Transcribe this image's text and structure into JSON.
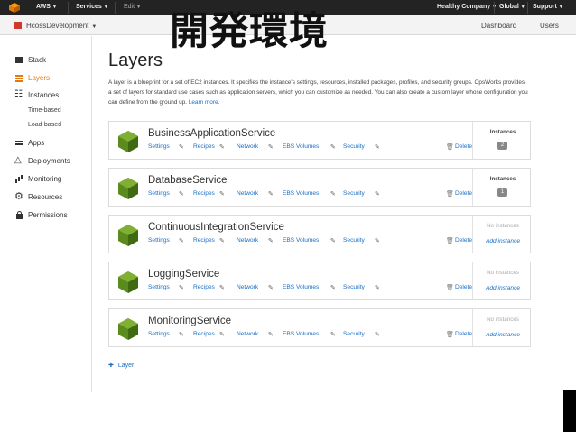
{
  "topbar": {
    "brand": "AWS",
    "services": "Services",
    "edit": "Edit",
    "account": "Healthy Company",
    "region": "Global",
    "support": "Support"
  },
  "subbar": {
    "stack_name": "HcossDevelopment",
    "dashboard": "Dashboard",
    "users": "Users"
  },
  "overlay_title": "開発環境",
  "sidebar": {
    "stack": "Stack",
    "layers": "Layers",
    "instances": "Instances",
    "time_based": "Time-based",
    "load_based": "Load-based",
    "apps": "Apps",
    "deployments": "Deployments",
    "monitoring": "Monitoring",
    "resources": "Resources",
    "permissions": "Permissions"
  },
  "main": {
    "title": "Layers",
    "description": "A layer is a blueprint for a set of EC2 instances. It specifies the instance's settings, resources, installed packages, profiles, and security groups. OpsWorks provides a set of layers for standard use cases such as application servers, which you can customize as needed. You can also create a custom layer whose configuration you can define from the ground up.",
    "learn_more": "Learn more.",
    "add_layer": "Layer"
  },
  "actions": {
    "settings": "Settings",
    "recipes": "Recipes",
    "network": "Network",
    "ebs": "EBS Volumes",
    "security": "Security",
    "delete": "Delete"
  },
  "layers": [
    {
      "name": "BusinessApplicationService",
      "instances_label": "Instances",
      "count": "2",
      "add": ""
    },
    {
      "name": "DatabaseService",
      "instances_label": "Instances",
      "count": "1",
      "add": ""
    },
    {
      "name": "ContinuousIntegrationService",
      "instances_label": "No instances",
      "count": "",
      "add": "Add instance"
    },
    {
      "name": "LoggingService",
      "instances_label": "No instances",
      "count": "",
      "add": "Add instance"
    },
    {
      "name": "MonitoringService",
      "instances_label": "No instances",
      "count": "",
      "add": "Add instance"
    }
  ],
  "colors": {
    "accent": "#e47911",
    "link": "#1a6fc4",
    "topbar": "#232323",
    "logo_green": "#5b8a1e"
  }
}
